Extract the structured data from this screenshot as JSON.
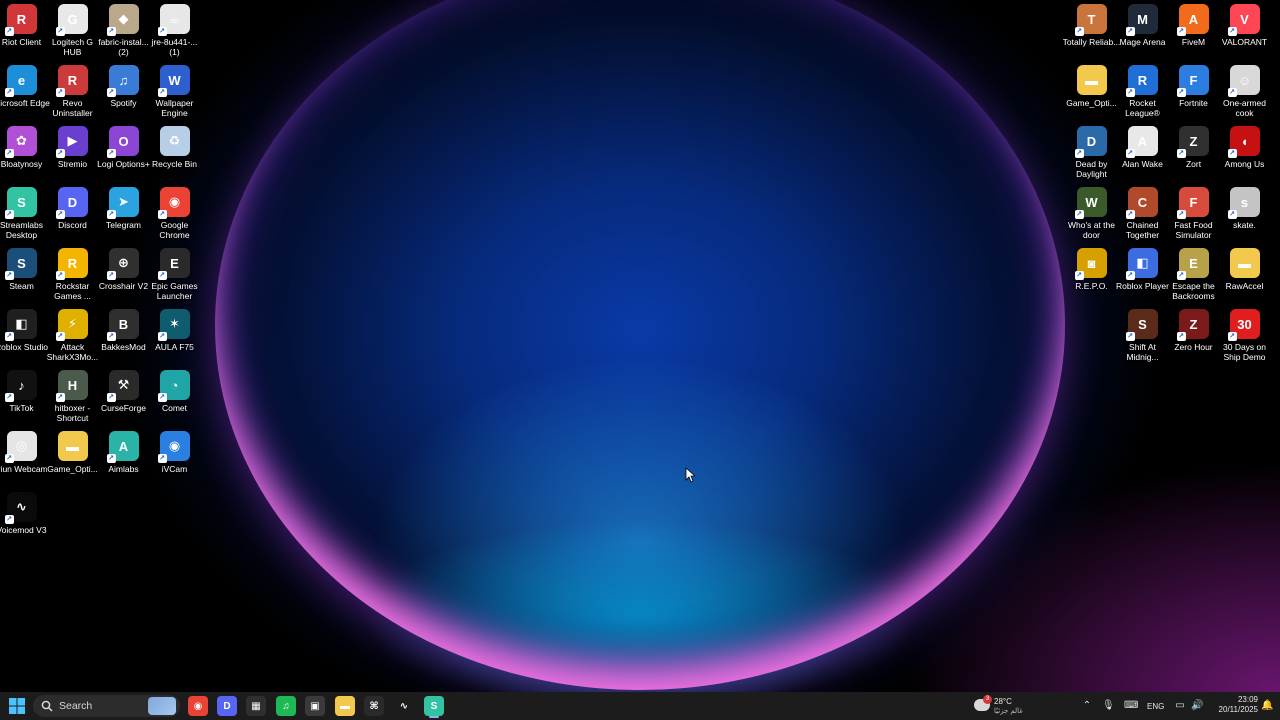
{
  "desktop": {
    "left_icons": [
      {
        "label": "Riot Client",
        "icon": "riot-client-icon",
        "color": "#d13639",
        "glyph": "R"
      },
      {
        "label": "Logitech G HUB",
        "icon": "logitech-ghub-icon",
        "color": "#e8e8e8",
        "glyph": "G"
      },
      {
        "label": "fabric-instal... (2)",
        "icon": "fabric-installer-icon",
        "color": "#b9a98a",
        "glyph": "◆"
      },
      {
        "label": "jre-8u441-... (1)",
        "icon": "java-installer-icon",
        "color": "#e7e7e7",
        "glyph": "☕"
      },
      {
        "label": "Microsoft Edge",
        "icon": "edge-icon",
        "color": "#1d8fd8",
        "glyph": "e"
      },
      {
        "label": "Revo Uninstaller",
        "icon": "revo-uninstaller-icon",
        "color": "#cc3b3b",
        "glyph": "R"
      },
      {
        "label": "Spotify",
        "icon": "spotify-shortcut-icon",
        "color": "#3a7bd5",
        "glyph": "♫"
      },
      {
        "label": "Wallpaper Engine",
        "icon": "wallpaper-engine-icon",
        "color": "#2d5fcf",
        "glyph": "W"
      },
      {
        "label": "Bloatynosy",
        "icon": "bloatynosy-icon",
        "color": "#b14fd6",
        "glyph": "✿"
      },
      {
        "label": "Stremio",
        "icon": "stremio-icon",
        "color": "#6a3fd0",
        "glyph": "▶"
      },
      {
        "label": "Logi Options+",
        "icon": "logi-options-icon",
        "color": "#8b46d6",
        "glyph": "O"
      },
      {
        "label": "Recycle Bin",
        "icon": "recycle-bin-icon",
        "color": "#b6cee6",
        "glyph": "♻"
      },
      {
        "label": "Streamlabs Desktop",
        "icon": "streamlabs-icon",
        "color": "#31c3a2",
        "glyph": "S"
      },
      {
        "label": "Discord",
        "icon": "discord-icon",
        "color": "#5865f2",
        "glyph": "D"
      },
      {
        "label": "Telegram",
        "icon": "telegram-icon",
        "color": "#2aa3e0",
        "glyph": "➤"
      },
      {
        "label": "Google Chrome",
        "icon": "chrome-icon",
        "color": "#ea4335",
        "glyph": "◉"
      },
      {
        "label": "Steam",
        "icon": "steam-icon",
        "color": "#1b4f7a",
        "glyph": "S"
      },
      {
        "label": "Rockstar Games ...",
        "icon": "rockstar-icon",
        "color": "#f4b400",
        "glyph": "R"
      },
      {
        "label": "Crosshair V2",
        "icon": "crosshair-icon",
        "color": "#303030",
        "glyph": "⊕"
      },
      {
        "label": "Epic Games Launcher",
        "icon": "epic-games-icon",
        "color": "#2a2a2a",
        "glyph": "E"
      },
      {
        "label": "Roblox Studio",
        "icon": "roblox-studio-icon",
        "color": "#1f1f1f",
        "glyph": "◧"
      },
      {
        "label": "Attack SharkX3Mo...",
        "icon": "attack-shark-icon",
        "color": "#e0b000",
        "glyph": "⚡"
      },
      {
        "label": "BakkesMod",
        "icon": "bakkesmod-icon",
        "color": "#2f2f2f",
        "glyph": "B"
      },
      {
        "label": "AULA F75",
        "icon": "aula-icon",
        "color": "#0f5c6e",
        "glyph": "✶"
      },
      {
        "label": "TikTok",
        "icon": "tiktok-icon",
        "color": "#111111",
        "glyph": "♪"
      },
      {
        "label": "hitboxer - Shortcut",
        "icon": "hitboxer-icon",
        "color": "#4b5b4b",
        "glyph": "H"
      },
      {
        "label": "CurseForge",
        "icon": "curseforge-icon",
        "color": "#2a2a2a",
        "glyph": "⚒"
      },
      {
        "label": "Comet",
        "icon": "comet-icon",
        "color": "#1fa5a5",
        "glyph": "◔"
      },
      {
        "label": "Iriun Webcam",
        "icon": "iriun-webcam-icon",
        "color": "#e5e5e5",
        "glyph": "◎"
      },
      {
        "label": "Game_Opti...",
        "icon": "folder-icon",
        "color": "#f2c94c",
        "glyph": "▬"
      },
      {
        "label": "Aimlabs",
        "icon": "aimlabs-icon",
        "color": "#2bb3a8",
        "glyph": "A"
      },
      {
        "label": "iVCam",
        "icon": "ivcam-icon",
        "color": "#2a7fe0",
        "glyph": "◉"
      },
      {
        "label": "Voicemod V3",
        "icon": "voicemod-icon",
        "color": "#0a0a0a",
        "glyph": "∿"
      }
    ],
    "right_icons": [
      {
        "label": "Totally Reliab...",
        "icon": "totally-reliable-icon",
        "color": "#c8743a",
        "glyph": "T"
      },
      {
        "label": "Mage Arena",
        "icon": "mage-arena-icon",
        "color": "#202a3a",
        "glyph": "M"
      },
      {
        "label": "FiveM",
        "icon": "fivem-icon",
        "color": "#f26b1d",
        "glyph": "A"
      },
      {
        "label": "VALORANT",
        "icon": "valorant-icon",
        "color": "#ff4655",
        "glyph": "V"
      },
      {
        "label": "Game_Opti...",
        "icon": "folder-icon",
        "color": "#f2c94c",
        "glyph": "▬"
      },
      {
        "label": "Rocket League®",
        "icon": "rocket-league-icon",
        "color": "#1f6fd6",
        "glyph": "R"
      },
      {
        "label": "Fortnite",
        "icon": "fortnite-icon",
        "color": "#2b7de0",
        "glyph": "F"
      },
      {
        "label": "One-armed cook",
        "icon": "one-armed-cook-icon",
        "color": "#d8d8d8",
        "glyph": "☺"
      },
      {
        "label": "Dead by Daylight",
        "icon": "dead-by-daylight-icon",
        "color": "#2b6aa8",
        "glyph": "D"
      },
      {
        "label": "Alan Wake",
        "icon": "alan-wake-icon",
        "color": "#e8e8e8",
        "glyph": "A"
      },
      {
        "label": "Zort",
        "icon": "zort-icon",
        "color": "#303030",
        "glyph": "Z"
      },
      {
        "label": "Among Us",
        "icon": "among-us-icon",
        "color": "#c51111",
        "glyph": "◖"
      },
      {
        "label": "Who's at the door",
        "icon": "whos-at-the-door-icon",
        "color": "#3a5a2a",
        "glyph": "W"
      },
      {
        "label": "Chained Together",
        "icon": "chained-together-icon",
        "color": "#b04a2a",
        "glyph": "C"
      },
      {
        "label": "Fast Food Simulator",
        "icon": "fast-food-simulator-icon",
        "color": "#d64b3b",
        "glyph": "F"
      },
      {
        "label": "skate.",
        "icon": "skate-icon",
        "color": "#c4c4c4",
        "glyph": "s"
      },
      {
        "label": "R.E.P.O.",
        "icon": "repo-icon",
        "color": "#d6a100",
        "glyph": "◙"
      },
      {
        "label": "Roblox Player",
        "icon": "roblox-player-icon",
        "color": "#3b6ce0",
        "glyph": "◧"
      },
      {
        "label": "Escape the Backrooms",
        "icon": "escape-backrooms-icon",
        "color": "#b7a24a",
        "glyph": "E"
      },
      {
        "label": "RawAccel",
        "icon": "folder-icon",
        "color": "#f2c94c",
        "glyph": "▬"
      },
      {
        "label": "Shift At Midnig...",
        "icon": "shift-at-midnight-icon",
        "color": "#5a2a1a",
        "glyph": "S"
      },
      {
        "label": "Zero Hour",
        "icon": "zero-hour-icon",
        "color": "#7a1a1a",
        "glyph": "Z"
      },
      {
        "label": "30 Days on Ship Demo",
        "icon": "30-days-on-ship-icon",
        "color": "#e01e1e",
        "glyph": "30"
      }
    ]
  },
  "taskbar": {
    "search_placeholder": "Search",
    "apps": [
      {
        "name": "chrome",
        "icon": "chrome-icon",
        "color": "#ea4335",
        "glyph": "◉"
      },
      {
        "name": "discord",
        "icon": "discord-icon",
        "color": "#5865f2",
        "glyph": "D"
      },
      {
        "name": "store",
        "icon": "store-icon",
        "color": "#2f2f2f",
        "glyph": "▦"
      },
      {
        "name": "spotify",
        "icon": "spotify-icon",
        "color": "#1db954",
        "glyph": "♫"
      },
      {
        "name": "photos",
        "icon": "photos-icon",
        "color": "#3a3a3a",
        "glyph": "▣"
      },
      {
        "name": "file explorer",
        "icon": "file-explorer-icon",
        "color": "#f2c94c",
        "glyph": "▬"
      },
      {
        "name": "game controller",
        "icon": "controller-icon",
        "color": "#2a2a2a",
        "glyph": "⌘"
      },
      {
        "name": "streamlabs",
        "icon": "streamlabs-taskbar-icon",
        "color": "#1c1c1c",
        "glyph": "∿"
      },
      {
        "name": "streamlabs desktop",
        "icon": "streamlabs-active-icon",
        "color": "#31c3a2",
        "glyph": "S"
      }
    ],
    "weather": {
      "temp": "28°C",
      "desc": "غالم جزئيًا",
      "badge": "3"
    },
    "language": "ENG",
    "time": "23:09",
    "date": "20/11/2025"
  }
}
